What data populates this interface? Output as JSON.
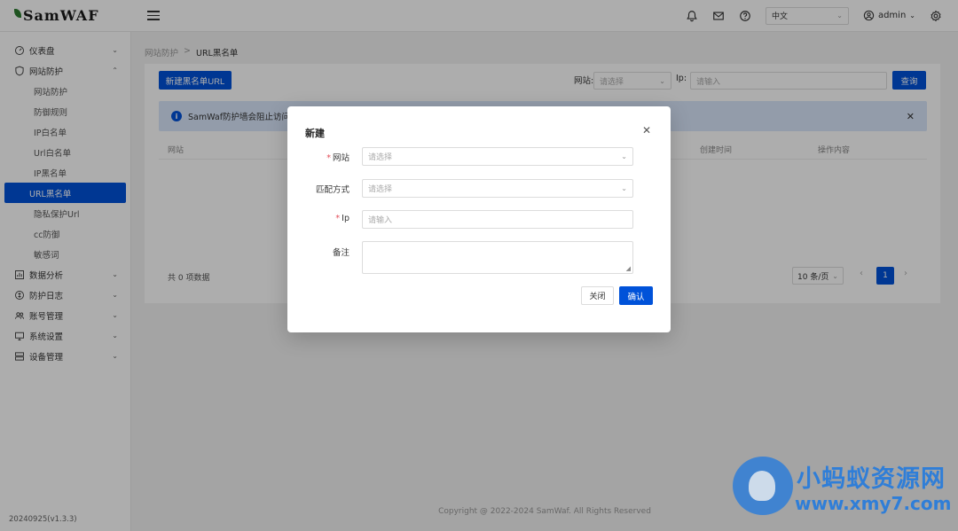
{
  "header": {
    "logo": "SamWAF",
    "language": "中文",
    "user": "admin"
  },
  "sidebar": {
    "groups": [
      {
        "label": "仪表盘"
      },
      {
        "label": "网站防护"
      }
    ],
    "sub_items": [
      "网站防护",
      "防御规则",
      "IP白名单",
      "Url白名单",
      "IP黑名单",
      "URL黑名单",
      "隐私保护Url",
      "cc防御",
      "敏感词"
    ],
    "groups_after": [
      "数据分析",
      "防护日志",
      "账号管理",
      "系统设置",
      "设备管理"
    ],
    "version": "20240925(v1.3.3)"
  },
  "breadcrumb": {
    "parent": "网站防护",
    "sep": ">",
    "current": "URL黑名单"
  },
  "toolbar": {
    "new_button": "新建黑名单URL",
    "site_label": "网站:",
    "site_placeholder": "请选择",
    "ip_label": "Ip:",
    "ip_placeholder": "请输入",
    "query_button": "查询"
  },
  "alert": {
    "text": "SamWaf防护墙会阻止访问任"
  },
  "table": {
    "headers": [
      "网站",
      "创建时间",
      "操作内容"
    ]
  },
  "pagination": {
    "total": "共 0 项数据",
    "page_size": "10 条/页",
    "current_page": "1"
  },
  "footer": "Copyright @ 2022-2024 SamWaf. All Rights Reserved",
  "dialog": {
    "title": "新建",
    "fields": [
      {
        "label": "网站",
        "required": "*",
        "placeholder": "请选择"
      },
      {
        "label": "匹配方式",
        "placeholder": "请选择"
      },
      {
        "label": "Ip",
        "required": "*",
        "placeholder": "请输入"
      },
      {
        "label": "备注"
      }
    ],
    "cancel": "关闭",
    "confirm": "确认"
  },
  "watermark": {
    "cn": "小蚂蚁资源网",
    "url": "www.xmy7.com"
  },
  "colors": {
    "primary": "#0052d9",
    "alert_bg": "#d9e6fb",
    "required": "#e34d59"
  }
}
